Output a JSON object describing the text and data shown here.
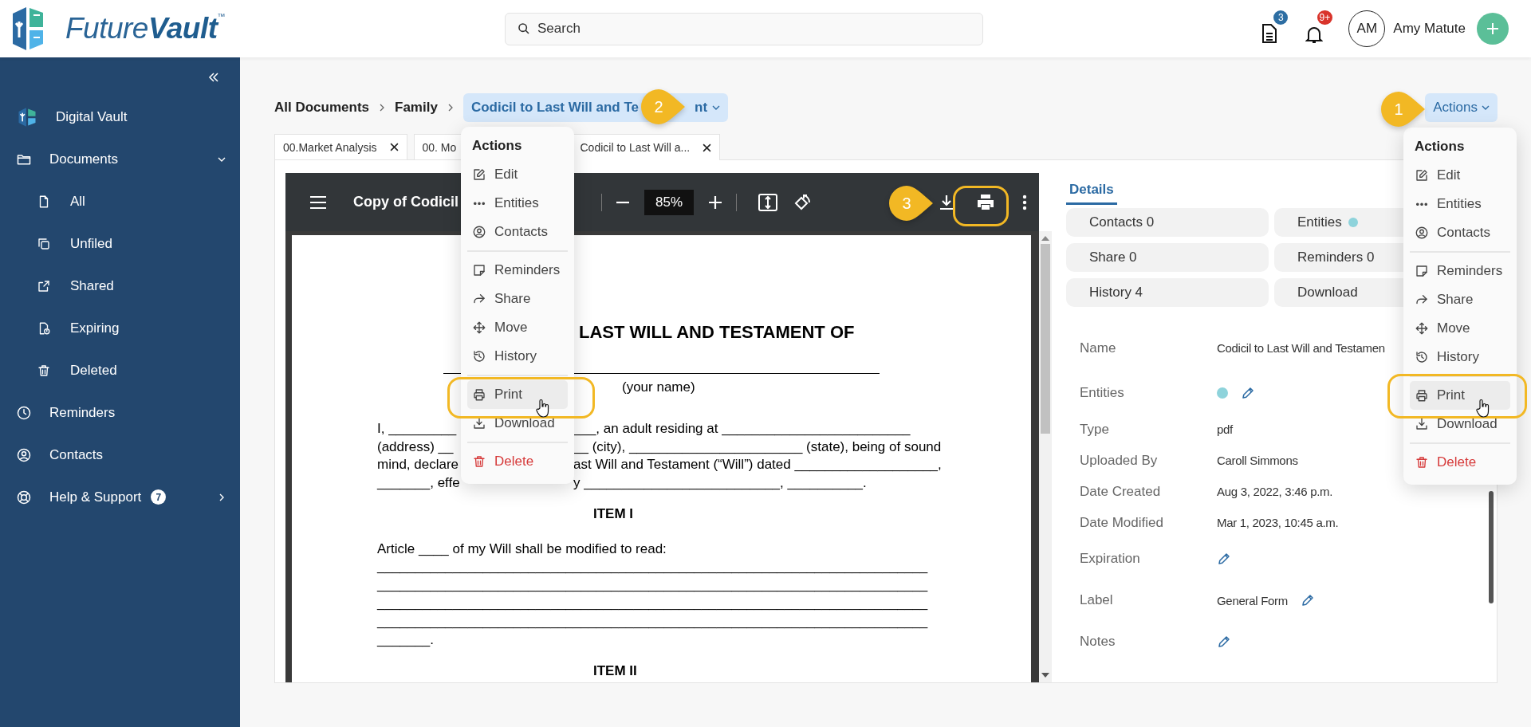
{
  "header": {
    "logo": {
      "prefix": "Future",
      "suffix": "Vault",
      "mark": "™"
    },
    "search": {
      "placeholder": "Search"
    },
    "documents_badge": "3",
    "notifications_badge": "9+",
    "user": {
      "initials": "AM",
      "name": "Amy Matute"
    }
  },
  "sidebar": {
    "items": [
      {
        "label": "Digital Vault"
      },
      {
        "label": "Documents",
        "expanded": true,
        "children": [
          {
            "label": "All"
          },
          {
            "label": "Unfiled"
          },
          {
            "label": "Shared"
          },
          {
            "label": "Expiring"
          },
          {
            "label": "Deleted"
          }
        ]
      },
      {
        "label": "Reminders"
      },
      {
        "label": "Contacts"
      },
      {
        "label": "Help & Support",
        "badge": "7",
        "expanded": false
      }
    ]
  },
  "breadcrumb": [
    {
      "label": "All Documents",
      "selected": false
    },
    {
      "label": "Family",
      "selected": false
    },
    {
      "label": "Codicil to Last Will and Te",
      "label_end": "nt",
      "selected": true
    }
  ],
  "actions_button": {
    "label": "Actions"
  },
  "tabs": [
    {
      "label": "00.Market Analysis",
      "selected": false,
      "closable": true
    },
    {
      "label": "00. Mo",
      "selected": false,
      "closable": false
    },
    {
      "label": "Codicil to Last Will a...",
      "selected": true,
      "closable": true
    }
  ],
  "viewer": {
    "title": "Copy of Codicil",
    "zoom": "85%"
  },
  "document": {
    "title": "LAST WILL AND TESTAMENT OF",
    "name_caption": "(your name)",
    "paragraph_lines": [
      {
        "left": "I, _________",
        "right": "___, an adult residing at _________________________"
      },
      {
        "left": "(address)  __",
        "right": "__ (city), _______________________ (state), being of sound"
      },
      {
        "left": "mind, declare",
        "right": "ast Will and Testament (“Will”) dated ___________________,"
      },
      {
        "left": "_______, effe",
        "right": "y __________________________, __________."
      }
    ],
    "item_1": "ITEM I",
    "article": "Article ____ of my Will shall be modified to read:",
    "blank_lines": [
      "_________________________________________________________________________",
      "_________________________________________________________________________",
      "_________________________________________________________________________",
      "_________________________________________________________________________",
      "_______."
    ],
    "item_2": "ITEM II"
  },
  "details": {
    "tab": {
      "label": "Details",
      "selected": true
    },
    "chips": [
      {
        "label": "Contacts 0"
      },
      {
        "label": "Entities",
        "color": "#8ed3db"
      },
      {
        "label": "Share 0"
      },
      {
        "label": "Reminders 0"
      },
      {
        "label": "History 4"
      },
      {
        "label": "Download"
      }
    ],
    "fields": [
      {
        "kind": "text",
        "label": "Name",
        "value": "Codicil to Last Will and Testamen"
      },
      {
        "kind": "entities",
        "label": "Entities",
        "color": "#8ed3db"
      },
      {
        "kind": "text",
        "label": "Type",
        "value": "pdf"
      },
      {
        "kind": "text",
        "label": "Uploaded By",
        "value": "Caroll Simmons"
      },
      {
        "kind": "text",
        "label": "Date Created",
        "value": "Aug 3, 2022, 3:46 p.m."
      },
      {
        "kind": "text",
        "label": "Date Modified",
        "value": "Mar 1, 2023, 10:45 a.m."
      },
      {
        "kind": "editable",
        "label": "Expiration"
      },
      {
        "kind": "editable",
        "label": "Label",
        "value": "General Form"
      },
      {
        "kind": "editable",
        "label": "Notes"
      }
    ]
  },
  "menus": [
    {
      "title": "Actions",
      "groups": [
        [
          {
            "kind": "edit",
            "label": "Edit",
            "selected": false
          },
          {
            "kind": "entities",
            "label": "Entities",
            "selected": false
          },
          {
            "kind": "contacts",
            "label": "Contacts",
            "selected": false
          }
        ],
        [
          {
            "kind": "reminders",
            "label": "Reminders",
            "selected": false
          },
          {
            "kind": "share",
            "label": "Share",
            "selected": false
          },
          {
            "kind": "move",
            "label": "Move",
            "selected": false
          },
          {
            "kind": "history",
            "label": "History",
            "selected": false
          }
        ],
        [
          {
            "kind": "print",
            "label": "Print",
            "selected": true
          },
          {
            "kind": "download",
            "label": "Download",
            "selected": false
          }
        ],
        [
          {
            "kind": "delete",
            "label": "Delete",
            "selected": false
          }
        ]
      ]
    },
    {
      "title": "Actions",
      "groups": [
        [
          {
            "kind": "edit",
            "label": "Edit",
            "selected": false
          },
          {
            "kind": "entities",
            "label": "Entities",
            "selected": false
          },
          {
            "kind": "contacts",
            "label": "Contacts",
            "selected": false
          }
        ],
        [
          {
            "kind": "reminders",
            "label": "Reminders",
            "selected": false
          },
          {
            "kind": "share",
            "label": "Share",
            "selected": false
          },
          {
            "kind": "move",
            "label": "Move",
            "selected": false
          },
          {
            "kind": "history",
            "label": "History",
            "selected": false
          }
        ],
        [
          {
            "kind": "print",
            "label": "Print",
            "selected": true
          },
          {
            "kind": "download",
            "label": "Download",
            "selected": false
          }
        ],
        [
          {
            "kind": "delete",
            "label": "Delete",
            "selected": false
          }
        ]
      ]
    }
  ],
  "callouts": [
    {
      "number": "1"
    },
    {
      "number": "2"
    },
    {
      "number": "3"
    }
  ]
}
